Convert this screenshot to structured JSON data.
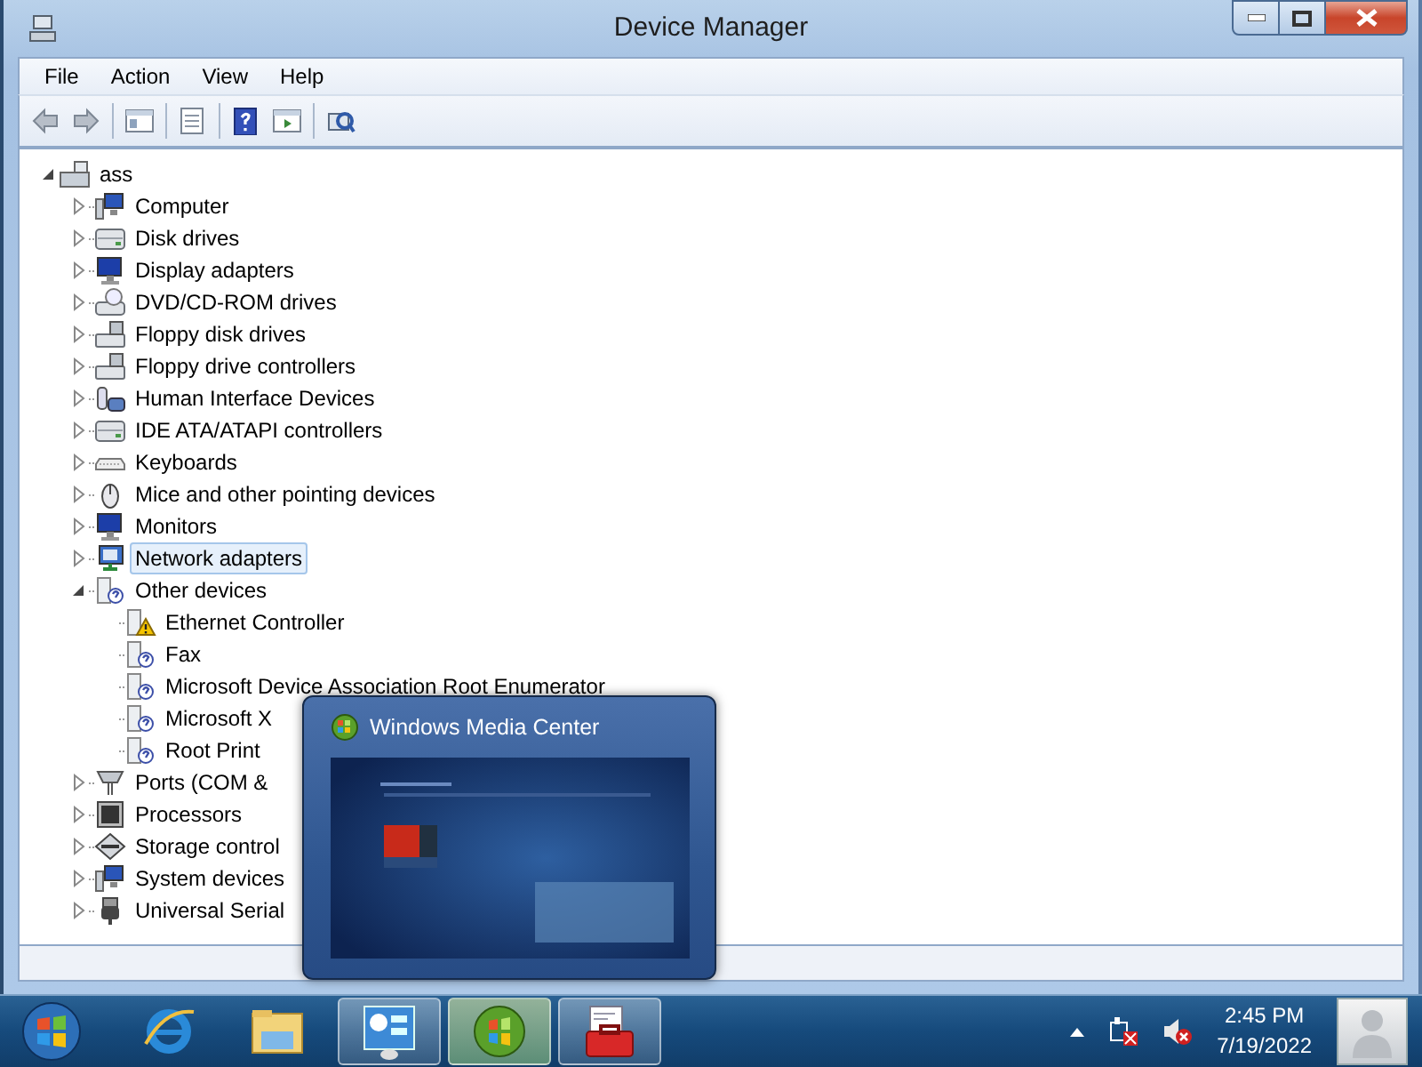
{
  "window": {
    "title": "Device Manager"
  },
  "menu": [
    "File",
    "Action",
    "View",
    "Help"
  ],
  "toolbar": [
    {
      "kind": "back"
    },
    {
      "kind": "forward"
    },
    {
      "kind": "separator"
    },
    {
      "kind": "tree"
    },
    {
      "kind": "separator"
    },
    {
      "kind": "properties"
    },
    {
      "kind": "separator"
    },
    {
      "kind": "help"
    },
    {
      "kind": "pane"
    },
    {
      "kind": "separator"
    },
    {
      "kind": "scan"
    }
  ],
  "tree": {
    "label": "ass",
    "expanded": true,
    "selected": false,
    "children": [
      {
        "label": "Computer",
        "expanded": false,
        "selected": false
      },
      {
        "label": "Disk drives",
        "expanded": false,
        "selected": false
      },
      {
        "label": "Display adapters",
        "expanded": false,
        "selected": false
      },
      {
        "label": "DVD/CD-ROM drives",
        "expanded": false,
        "selected": false
      },
      {
        "label": "Floppy disk drives",
        "expanded": false,
        "selected": false
      },
      {
        "label": "Floppy drive controllers",
        "expanded": false,
        "selected": false
      },
      {
        "label": "Human Interface Devices",
        "expanded": false,
        "selected": false
      },
      {
        "label": "IDE ATA/ATAPI controllers",
        "expanded": false,
        "selected": false
      },
      {
        "label": "Keyboards",
        "expanded": false,
        "selected": false
      },
      {
        "label": "Mice and other pointing devices",
        "expanded": false,
        "selected": false
      },
      {
        "label": "Monitors",
        "expanded": false,
        "selected": false
      },
      {
        "label": "Network adapters",
        "expanded": false,
        "selected": true
      },
      {
        "label": "Other devices",
        "expanded": true,
        "selected": false,
        "children": [
          {
            "label": "Ethernet Controller",
            "warning": true,
            "selected": false
          },
          {
            "label": "Fax",
            "warning": false,
            "selected": false
          },
          {
            "label": "Microsoft Device Association Root Enumerator",
            "warning": false,
            "selected": false
          },
          {
            "label": "Microsoft X",
            "warning": false,
            "selected": false
          },
          {
            "label": "Root Print",
            "warning": false,
            "selected": false
          }
        ]
      },
      {
        "label": "Ports (COM &",
        "expanded": false,
        "selected": false
      },
      {
        "label": "Processors",
        "expanded": false,
        "selected": false
      },
      {
        "label": "Storage control",
        "expanded": false,
        "selected": false
      },
      {
        "label": "System devices",
        "expanded": false,
        "selected": false
      },
      {
        "label": "Universal Serial",
        "expanded": false,
        "selected": false
      }
    ]
  },
  "preview": {
    "title": "Windows Media Center"
  },
  "taskbar": {
    "items": [
      {
        "kind": "start",
        "running": false,
        "hovered": false
      },
      {
        "kind": "browser",
        "running": false,
        "hovered": false
      },
      {
        "kind": "folder",
        "running": false,
        "hovered": false
      },
      {
        "kind": "panel",
        "running": true,
        "hovered": false
      },
      {
        "kind": "media",
        "running": true,
        "hovered": true
      },
      {
        "kind": "toolbox",
        "running": true,
        "hovered": false
      }
    ],
    "tray": [
      {
        "kind": "overflow"
      },
      {
        "kind": "network",
        "error": true
      },
      {
        "kind": "volume",
        "muted": true
      }
    ],
    "clock": {
      "time": "2:45 PM",
      "date": "7/19/2022"
    }
  }
}
